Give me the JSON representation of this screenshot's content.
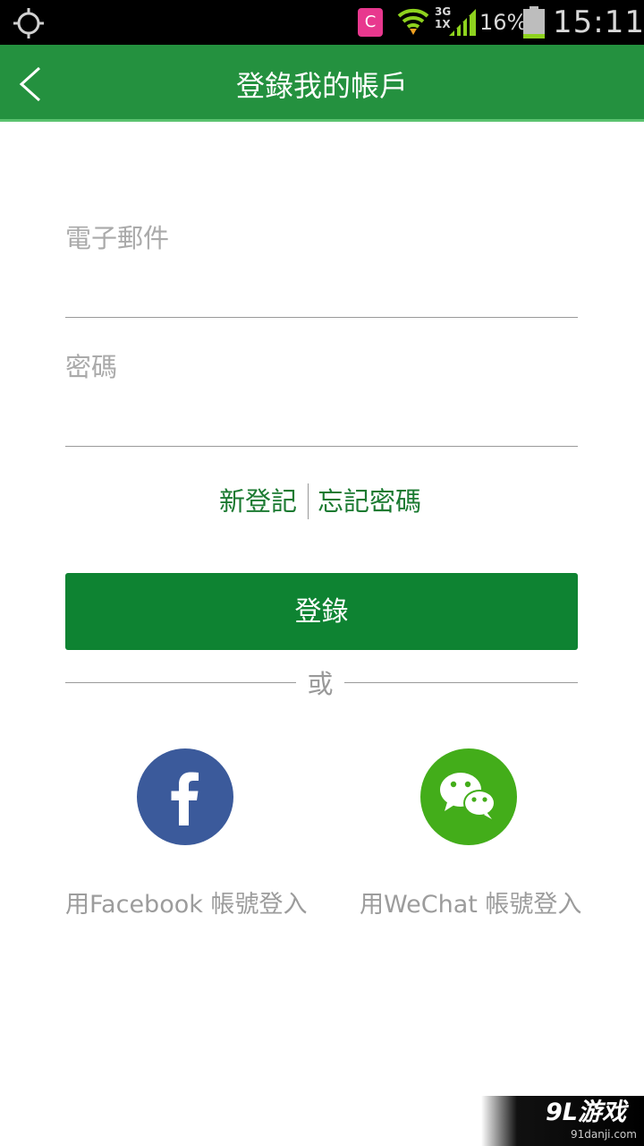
{
  "status_bar": {
    "notification_app_letter": "C",
    "network_type_top": "3G",
    "network_type_bottom": "1X",
    "battery_percent": "16%",
    "battery_level": 0.16,
    "clock": "15:11",
    "icons": [
      "gps-icon",
      "app-notification-icon",
      "wifi-icon",
      "signal-icon",
      "battery-icon"
    ]
  },
  "app_bar": {
    "title": "登錄我的帳戶",
    "back_icon": "chevron-left-icon"
  },
  "form": {
    "email_placeholder": "電子郵件",
    "email_value": "",
    "password_placeholder": "密碼",
    "password_value": "",
    "register_link": "新登記",
    "forgot_password_link": "忘記密碼",
    "login_button": "登錄",
    "or_separator": "或"
  },
  "social": {
    "facebook_label": "用Facebook 帳號登入",
    "wechat_label": "用WeChat 帳號登入",
    "facebook_icon": "facebook-icon",
    "wechat_icon": "wechat-icon"
  },
  "colors": {
    "app_bar": "#24913f",
    "link": "#1b7a31",
    "login_button": "#0e8332",
    "facebook": "#3b5a9b",
    "wechat": "#43ad1a"
  },
  "watermark": {
    "brand": "9L游戏",
    "url": "91danji.com"
  }
}
